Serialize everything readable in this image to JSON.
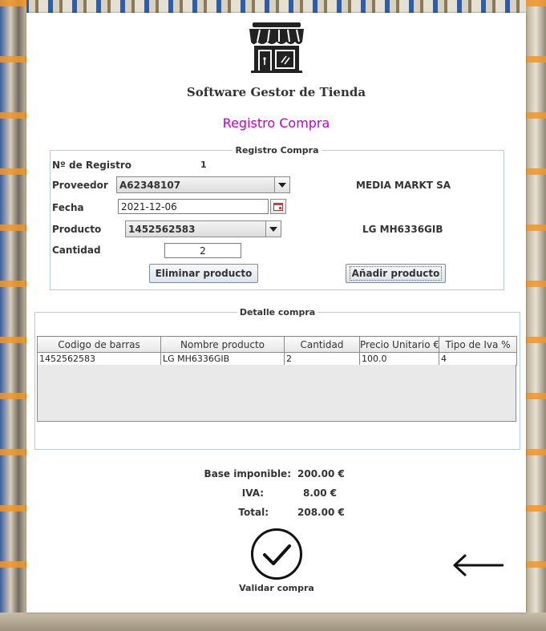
{
  "app": {
    "brand": "Software Gestor de Tienda",
    "window_title": "Registro Compra",
    "logo_icon": "store-icon",
    "title_color": "#c000c8"
  },
  "form": {
    "legend": "Registro Compra",
    "registro_label": "Nº de Registro",
    "registro_value": "1",
    "proveedor_label": "Proveedor",
    "proveedor_value": "A62348107",
    "proveedor_name": "MEDIA MARKT SA",
    "fecha_label": "Fecha",
    "fecha_value": "2021-12-06",
    "producto_label": "Producto",
    "producto_value": "1452562583",
    "producto_name": "LG MH6336GIB",
    "cantidad_label": "Cantidad",
    "cantidad_value": "2",
    "eliminar_label": "Eliminar producto",
    "anadir_label": "Añadir producto"
  },
  "detail": {
    "legend": "Detalle compra",
    "columns": [
      "Codigo de barras",
      "Nombre producto",
      "Cantidad",
      "Precio Unitario €",
      "Tipo de Iva %"
    ],
    "rows": [
      [
        "1452562583",
        "LG MH6336GIB",
        "2",
        "100.0",
        "4"
      ]
    ]
  },
  "totals": {
    "base_label": "Base imponible:",
    "base_value": "200.00 €",
    "iva_label": "IVA:",
    "iva_value": "8.00 €",
    "total_label": "Total:",
    "total_value": "208.00 €"
  },
  "actions": {
    "validar_label": "Validar compra",
    "validar_icon": "check-circle-icon",
    "back_icon": "arrow-left-icon"
  }
}
